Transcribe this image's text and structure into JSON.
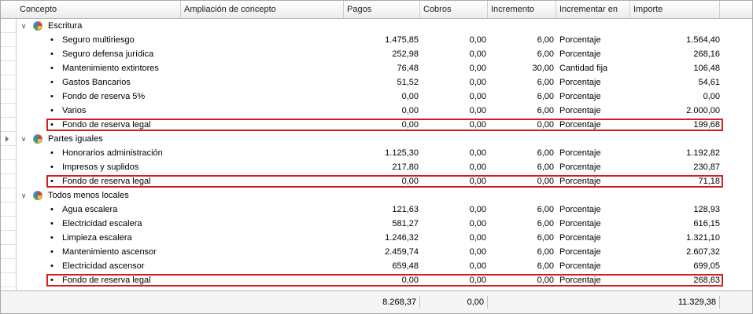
{
  "columns": {
    "concepto": "Concepto",
    "ampliacion": "Ampliación de concepto",
    "pagos": "Pagos",
    "cobros": "Cobros",
    "incremento": "Incremento",
    "incrementar_en": "Incrementar en",
    "importe": "Importe"
  },
  "groups": [
    {
      "label": "Escritura",
      "rows": [
        {
          "concepto": "Seguro multiriesgo",
          "pagos": "1.475,85",
          "cobros": "0,00",
          "incremento": "6,00",
          "incrementar_en": "Porcentaje",
          "importe": "1.564,40",
          "highlighted": false
        },
        {
          "concepto": "Seguro defensa jurídica",
          "pagos": "252,98",
          "cobros": "0,00",
          "incremento": "6,00",
          "incrementar_en": "Porcentaje",
          "importe": "268,16",
          "highlighted": false
        },
        {
          "concepto": "Mantenimiento extintores",
          "pagos": "76,48",
          "cobros": "0,00",
          "incremento": "30,00",
          "incrementar_en": "Cantidad fija",
          "importe": "106,48",
          "highlighted": false
        },
        {
          "concepto": "Gastos Bancarios",
          "pagos": "51,52",
          "cobros": "0,00",
          "incremento": "6,00",
          "incrementar_en": "Porcentaje",
          "importe": "54,61",
          "highlighted": false
        },
        {
          "concepto": "Fondo de reserva 5%",
          "pagos": "0,00",
          "cobros": "0,00",
          "incremento": "6,00",
          "incrementar_en": "Porcentaje",
          "importe": "0,00",
          "highlighted": false
        },
        {
          "concepto": "Varios",
          "pagos": "0,00",
          "cobros": "0,00",
          "incremento": "6,00",
          "incrementar_en": "Porcentaje",
          "importe": "2.000,00",
          "highlighted": false
        },
        {
          "concepto": "Fondo de reserva legal",
          "pagos": "0,00",
          "cobros": "0,00",
          "incremento": "0,00",
          "incrementar_en": "Porcentaje",
          "importe": "199,68",
          "highlighted": true
        }
      ]
    },
    {
      "label": "Partes iguales",
      "rows": [
        {
          "concepto": "Honorarios administración",
          "pagos": "1.125,30",
          "cobros": "0,00",
          "incremento": "6,00",
          "incrementar_en": "Porcentaje",
          "importe": "1.192,82",
          "highlighted": false
        },
        {
          "concepto": "Impresos y suplidos",
          "pagos": "217,80",
          "cobros": "0,00",
          "incremento": "6,00",
          "incrementar_en": "Porcentaje",
          "importe": "230,87",
          "highlighted": false
        },
        {
          "concepto": "Fondo de reserva legal",
          "pagos": "0,00",
          "cobros": "0,00",
          "incremento": "0,00",
          "incrementar_en": "Porcentaje",
          "importe": "71,18",
          "highlighted": true
        }
      ]
    },
    {
      "label": "Todos menos locales",
      "rows": [
        {
          "concepto": "Agua escalera",
          "pagos": "121,63",
          "cobros": "0,00",
          "incremento": "6,00",
          "incrementar_en": "Porcentaje",
          "importe": "128,93",
          "highlighted": false
        },
        {
          "concepto": "Electricidad escalera",
          "pagos": "581,27",
          "cobros": "0,00",
          "incremento": "6,00",
          "incrementar_en": "Porcentaje",
          "importe": "616,15",
          "highlighted": false
        },
        {
          "concepto": "Limpieza escalera",
          "pagos": "1.246,32",
          "cobros": "0,00",
          "incremento": "6,00",
          "incrementar_en": "Porcentaje",
          "importe": "1.321,10",
          "highlighted": false
        },
        {
          "concepto": "Mantenimiento ascensor",
          "pagos": "2.459,74",
          "cobros": "0,00",
          "incremento": "6,00",
          "incrementar_en": "Porcentaje",
          "importe": "2.607,32",
          "highlighted": false
        },
        {
          "concepto": "Electricidad ascensor",
          "pagos": "659,48",
          "cobros": "0,00",
          "incremento": "6,00",
          "incrementar_en": "Porcentaje",
          "importe": "699,05",
          "highlighted": false
        },
        {
          "concepto": "Fondo de reserva legal",
          "pagos": "0,00",
          "cobros": "0,00",
          "incremento": "0,00",
          "incrementar_en": "Porcentaje",
          "importe": "268,63",
          "highlighted": true
        }
      ]
    }
  ],
  "totals": {
    "pagos": "8.268,37",
    "cobros": "0,00",
    "importe": "11.329,38"
  },
  "icons": {
    "group": "group-pie-icon",
    "expanded": "chevron-down-icon",
    "row_indicator": "row-indicator-arrow-icon"
  },
  "colors": {
    "highlight_border": "#d41e1e"
  }
}
